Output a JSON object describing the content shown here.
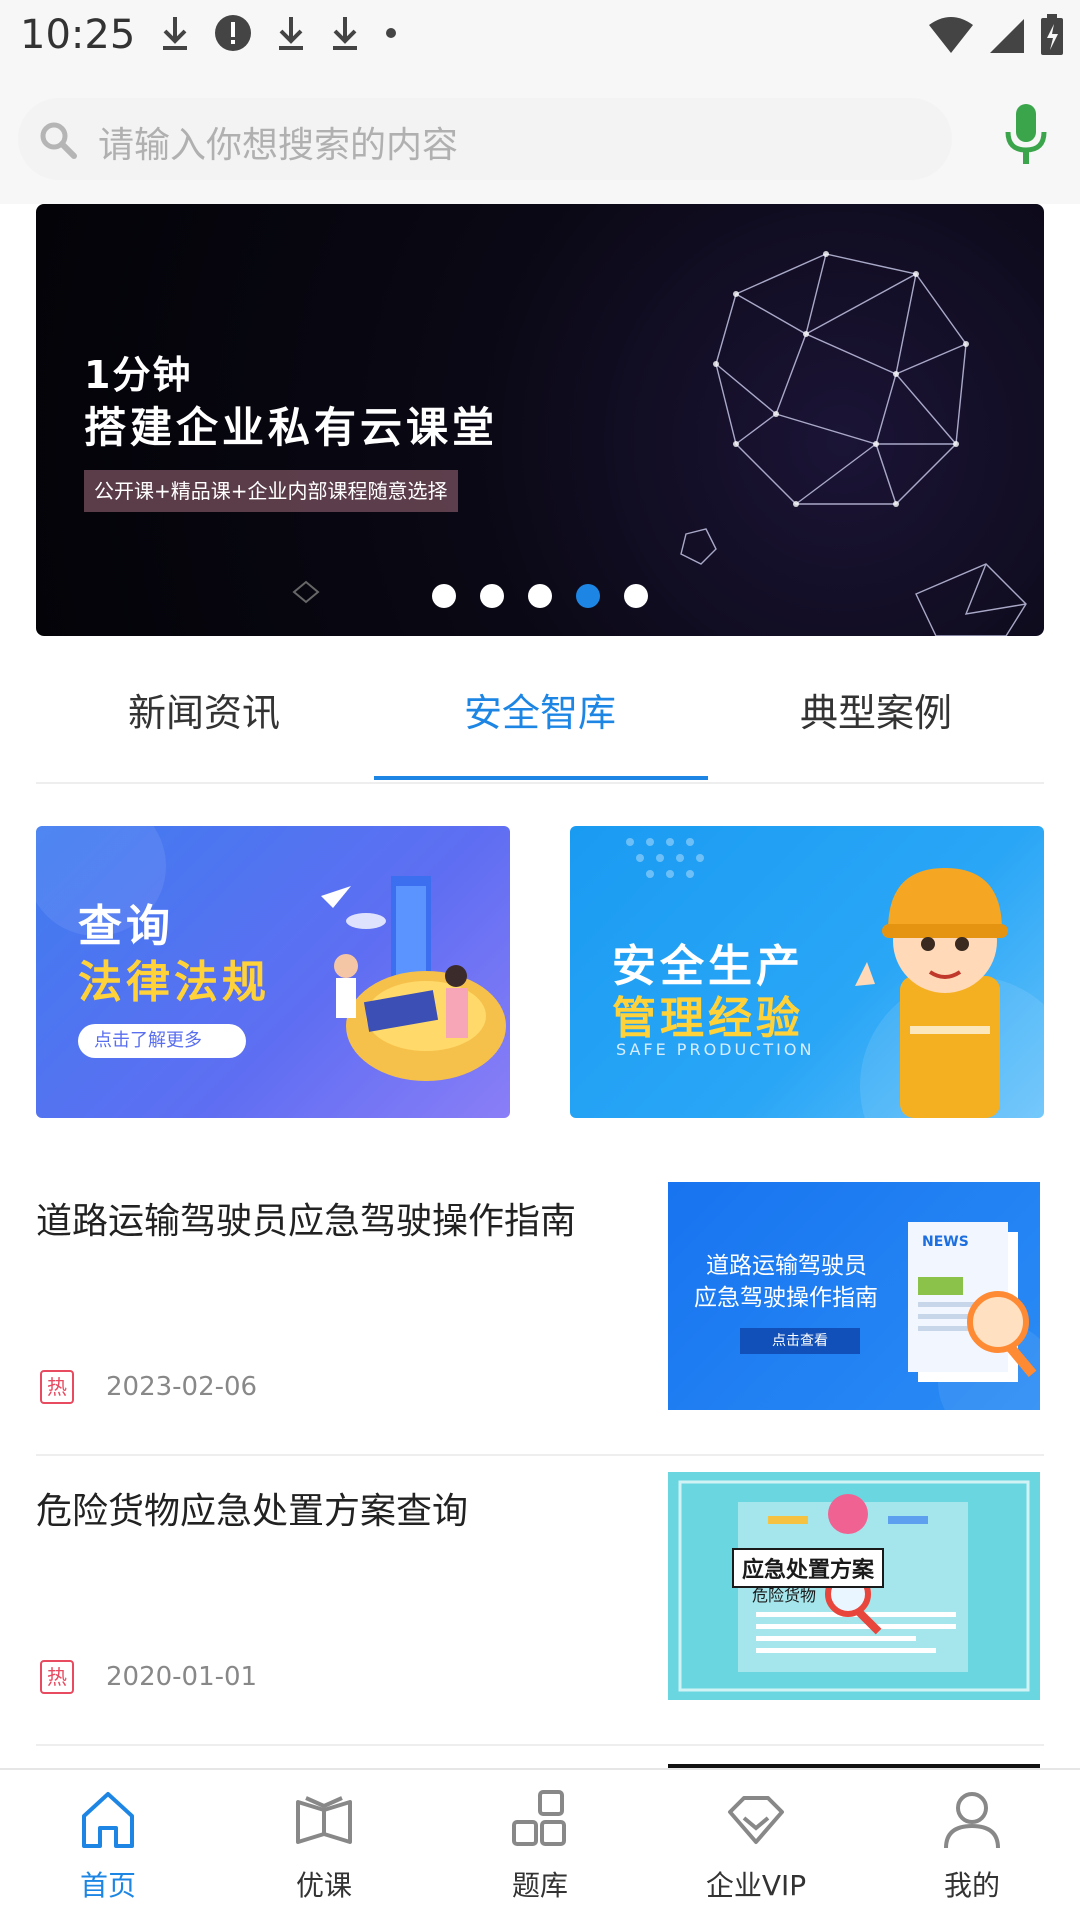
{
  "status_bar": {
    "time": "10:25",
    "left_icons": [
      "download-icon",
      "alert-icon",
      "download-icon",
      "download-icon",
      "dot-icon"
    ],
    "right_icons": [
      "wifi-icon",
      "signal-icon",
      "battery-icon"
    ]
  },
  "search": {
    "placeholder": "请输入你想搜索的内容",
    "accent": "#3aa54a"
  },
  "banner": {
    "line1": "1分钟",
    "line2": "搭建企业私有云课堂",
    "subtitle": "公开课+精品课+企业内部课程随意选择",
    "dot_count": 5,
    "active_dot": 3
  },
  "tabs": {
    "items": [
      "新闻资讯",
      "安全智库",
      "典型案例"
    ],
    "active": 1,
    "active_color": "#1d86e4"
  },
  "cards": [
    {
      "line1": "查询",
      "line2": "法律法规",
      "button": "点击了解更多"
    },
    {
      "line1": "安全生产",
      "line2": "管理经验",
      "sub": "SAFE PRODUCTION"
    }
  ],
  "news": [
    {
      "title": "道路运输驾驶员应急驾驶操作指南",
      "badge": "热",
      "date": "2023-02-06",
      "thumb": {
        "line1": "道路运输驾驶员",
        "line2": "应急驾驶操作指南",
        "button": "点击查看",
        "tag": "NEWS"
      }
    },
    {
      "title": "危险货物应急处置方案查询",
      "badge": "热",
      "date": "2020-01-01",
      "thumb": {
        "heading": "应急处置方案",
        "sub": "危险货物"
      }
    }
  ],
  "bottom_nav": {
    "items": [
      {
        "label": "首页",
        "icon": "home-icon"
      },
      {
        "label": "优课",
        "icon": "book-icon"
      },
      {
        "label": "题库",
        "icon": "grid-icon"
      },
      {
        "label": "企业VIP",
        "icon": "diamond-icon"
      },
      {
        "label": "我的",
        "icon": "user-icon"
      }
    ],
    "active": 0,
    "active_color": "#1d86e4",
    "inactive_color": "#888888"
  }
}
